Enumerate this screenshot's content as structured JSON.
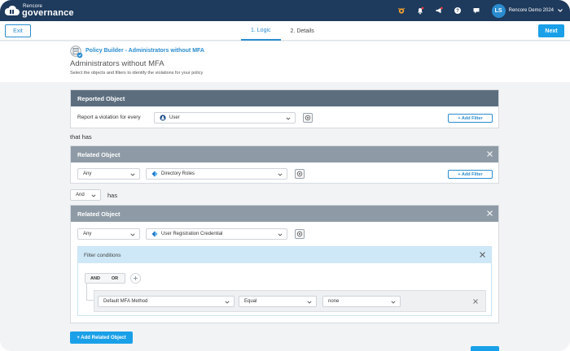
{
  "app": {
    "brand_small": "Rencore",
    "brand_big": "governance"
  },
  "topbar": {
    "icons": [
      "bug-icon",
      "bell-icon",
      "megaphone-icon",
      "help-icon",
      "chat-icon"
    ],
    "user_initials": "LS",
    "user_name": "Rencore Demo 2024"
  },
  "subbar": {
    "exit_label": "Exit",
    "tabs": [
      {
        "label": "1. Logic",
        "active": true
      },
      {
        "label": "2. Details",
        "active": false
      }
    ],
    "next_label": "Next"
  },
  "header": {
    "breadcrumb": "Policy Builder - Administrators without MFA",
    "title": "Administrators without MFA",
    "subtitle": "Select the objects and filters to identify the violations for your policy"
  },
  "reported": {
    "head": "Reported Object",
    "prompt": "Report a violation for every",
    "object": "User",
    "add_filter": "+ Add Filter"
  },
  "that_has": "that has",
  "related1": {
    "head": "Related Object",
    "quantifier": "Any",
    "object": "Directory Roles",
    "add_filter": "+ Add Filter"
  },
  "connector": {
    "operator": "And",
    "has": "has"
  },
  "related2": {
    "head": "Related Object",
    "quantifier": "Any",
    "object": "User Registration Credential",
    "filter": {
      "head": "Filter conditions",
      "and_label": "AND",
      "or_label": "OR",
      "condition": {
        "field": "Default MFA Method",
        "operator": "Equal",
        "value": "none"
      }
    }
  },
  "add_related_label": "+ Add Related Object",
  "colors": {
    "navy": "#1e3a5c",
    "accent": "#1aa0e8",
    "link": "#2a8ccf"
  }
}
